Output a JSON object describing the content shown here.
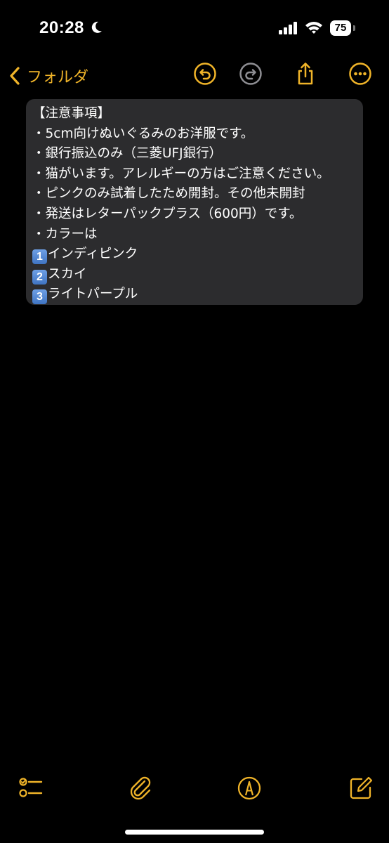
{
  "status_bar": {
    "time": "20:28",
    "battery_level": "75",
    "icons": [
      "moon-icon",
      "cellular-signal-icon",
      "wifi-icon",
      "battery-icon"
    ]
  },
  "nav": {
    "back_label": "フォルダ",
    "icons": [
      "chevron-left-icon",
      "undo-icon",
      "redo-icon",
      "share-icon",
      "more-icon"
    ],
    "accent_color": "#f0b429"
  },
  "note": {
    "lines": [
      {
        "text": "【注意事項】"
      },
      {
        "text": "・5cm向けぬいぐるみのお洋服です。"
      },
      {
        "text": "・銀行振込のみ（三菱UFJ銀行）"
      },
      {
        "text": "・猫がいます。アレルギーの方はご注意ください。"
      },
      {
        "text": "・ピンクのみ試着したため開封。その他未開封"
      },
      {
        "text": "・発送はレターパックプラス（600円）です。"
      },
      {
        "text": "・カラーは"
      },
      {
        "keycap": "1",
        "text": "インディピンク"
      },
      {
        "keycap": "2",
        "text": "スカイ"
      },
      {
        "keycap": "3",
        "text": "ライトパープル"
      }
    ]
  },
  "toolbar": {
    "icons": [
      "checklist-icon",
      "paperclip-icon",
      "markup-pen-icon",
      "compose-icon"
    ]
  }
}
